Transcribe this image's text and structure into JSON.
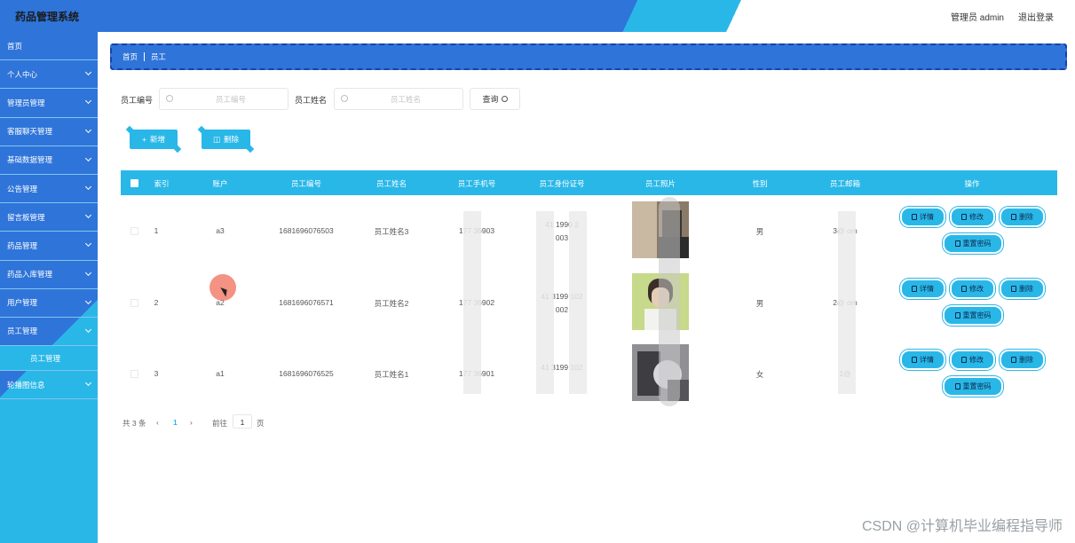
{
  "app": {
    "title": "药品管理系统",
    "user_label": "管理员 admin",
    "logout_label": "退出登录"
  },
  "sidebar": {
    "items": [
      {
        "label": "首页",
        "has_arrow": false
      },
      {
        "label": "个人中心",
        "has_arrow": true
      },
      {
        "label": "管理员管理",
        "has_arrow": true
      },
      {
        "label": "客服聊天管理",
        "has_arrow": true
      },
      {
        "label": "基础数据管理",
        "has_arrow": true
      },
      {
        "label": "公告管理",
        "has_arrow": true
      },
      {
        "label": "留言板管理",
        "has_arrow": true
      },
      {
        "label": "药品管理",
        "has_arrow": true
      },
      {
        "label": "药品入库管理",
        "has_arrow": true
      },
      {
        "label": "用户管理",
        "has_arrow": true
      },
      {
        "label": "员工管理",
        "has_arrow": true
      },
      {
        "label": "员工管理",
        "is_sub": true
      },
      {
        "label": "轮播图信息",
        "has_arrow": true
      }
    ]
  },
  "breadcrumb": {
    "home": "首页",
    "current": "员工"
  },
  "search": {
    "field1_label": "员工编号",
    "field1_placeholder": "员工编号",
    "field2_label": "员工姓名",
    "field2_placeholder": "员工姓名",
    "query_label": "查询"
  },
  "actions": {
    "add_label": "新增",
    "delete_label": "删除"
  },
  "table": {
    "headers": [
      "索引",
      "账户",
      "员工编号",
      "员工姓名",
      "员工手机号",
      "员工身份证号",
      "员工照片",
      "性别",
      "员工邮箱",
      "操作"
    ],
    "op_labels": {
      "detail": "详情",
      "edit": "修改",
      "delete": "删除",
      "reset": "重置密码"
    },
    "rows": [
      {
        "index": "1",
        "account": "a3",
        "emp_no": "1681696076503",
        "name": "员工姓名3",
        "phone": "177 36903",
        "id_line1": "41 1990 2",
        "id_line2": "003",
        "gender": "男",
        "email": "3@ om"
      },
      {
        "index": "2",
        "account": "a2",
        "emp_no": "1681696076571",
        "name": "员工姓名2",
        "phone": "177 36902",
        "id_line1": "41 3199 102",
        "id_line2": "002",
        "gender": "男",
        "email": "2@ om"
      },
      {
        "index": "3",
        "account": "a1",
        "emp_no": "1681696076525",
        "name": "员工姓名1",
        "phone": "177 36901",
        "id_line1": "41 3199 102",
        "id_line2": "",
        "gender": "女",
        "email": "1@"
      }
    ]
  },
  "pager": {
    "total": "共 3 条",
    "prev": "‹",
    "current_page": "1",
    "next": "›",
    "goto_prefix": "前往",
    "goto_value": "1",
    "goto_suffix": "页"
  },
  "watermark": "CSDN @计算机毕业编程指导师",
  "colors": {
    "primary": "#2f74d9",
    "accent": "#29b7e8"
  }
}
